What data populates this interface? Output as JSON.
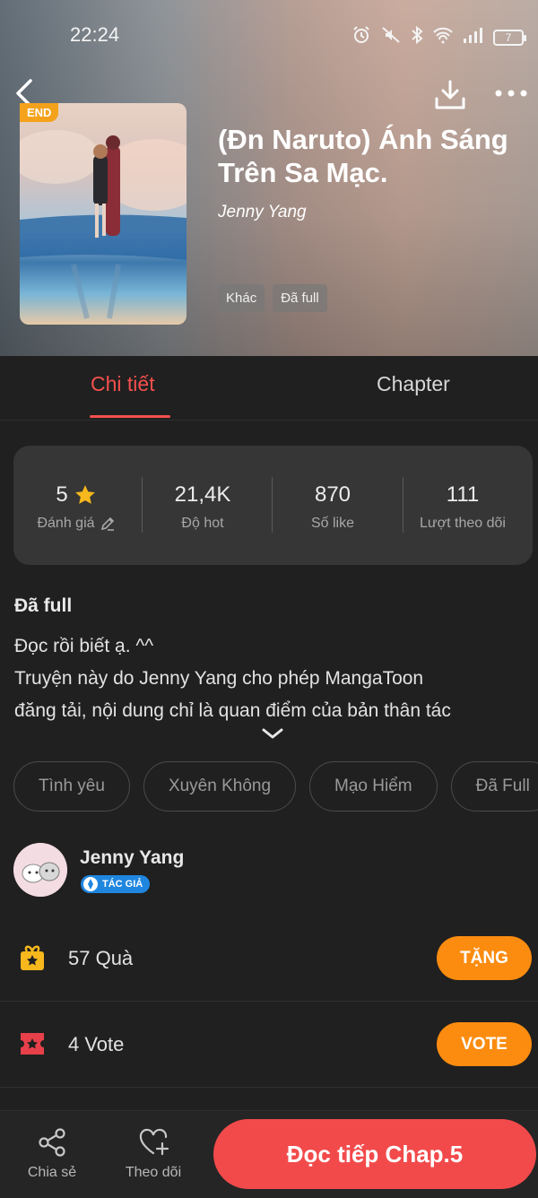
{
  "status_bar": {
    "time": "22:24",
    "battery": "7"
  },
  "book": {
    "end_badge": "END",
    "title": "(Đn Naruto) Ánh Sáng Trên Sa Mạc.",
    "author": "Jenny Yang",
    "tags": [
      "Khác",
      "Đã full"
    ]
  },
  "tabs": [
    {
      "label": "Chi tiết",
      "active": true
    },
    {
      "label": "Chapter",
      "active": false
    }
  ],
  "stats": {
    "rating": {
      "value": "5",
      "label": "Đánh giá"
    },
    "hot": {
      "value": "21,4K",
      "label": "Độ hot"
    },
    "likes": {
      "value": "870",
      "label": "Số like"
    },
    "follows": {
      "value": "111",
      "label": "Lượt theo dõi"
    }
  },
  "description": {
    "status": "Đã full",
    "lines": [
      "Đọc rồi biết ạ. ^^",
      "Truyện này do Jenny Yang cho phép MangaToon",
      "đăng tải, nội dung chỉ là quan điểm của bản thân tác"
    ]
  },
  "genres": [
    "Tình yêu",
    "Xuyên Không",
    "Mạo Hiểm",
    "Đã Full"
  ],
  "author_section": {
    "name": "Jenny Yang",
    "badge": "TÁC GIẢ"
  },
  "gifts": {
    "text": "57  Quà",
    "button": "TẶNG"
  },
  "votes": {
    "text": "4  Vote",
    "button": "VOTE"
  },
  "bottom_bar": {
    "share_label": "Chia sẻ",
    "follow_label": "Theo dõi",
    "read_button": "Đọc tiếp Chap.5"
  },
  "colors": {
    "accent_red": "#f4504e",
    "button_orange": "#fb8c10",
    "star_yellow": "#f6b81c",
    "background": "#202020"
  }
}
